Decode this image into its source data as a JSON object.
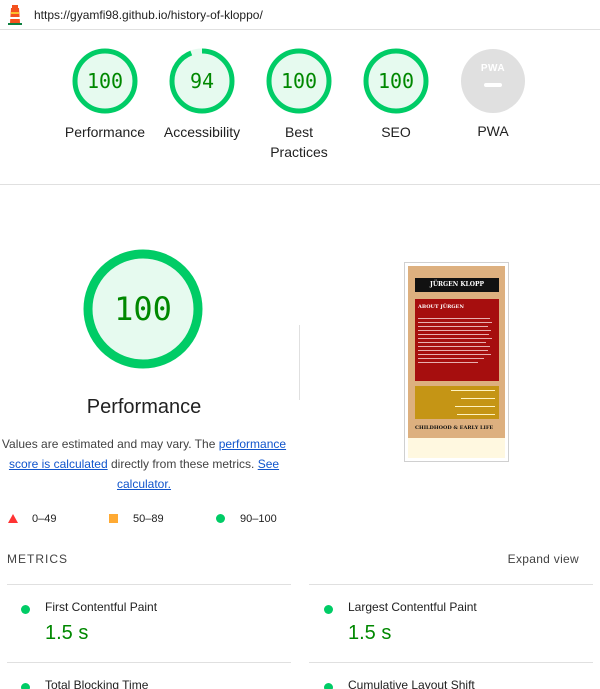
{
  "browser": {
    "url": "https://gyamfi98.github.io/history-of-kloppo/"
  },
  "summary": {
    "gauges": [
      {
        "score": "100",
        "label": "Performance"
      },
      {
        "score": "94",
        "label": "Accessibility"
      },
      {
        "score": "100",
        "label": "Best\nPractices"
      },
      {
        "score": "100",
        "label": "SEO"
      },
      {
        "badge": "PWA",
        "label": "PWA"
      }
    ]
  },
  "performance": {
    "score": "100",
    "title": "Performance",
    "desc_prefix": "Values are estimated and may vary. The ",
    "desc_link": "performance score is calculated",
    "desc_mid": " directly from these metrics. ",
    "desc_calc": "See calculator."
  },
  "legend": {
    "fail": "0–49",
    "average": "50–89",
    "pass": "90–100"
  },
  "screenshot": {
    "title": "JÜRGEN KLOPP",
    "about_heading": "ABOUT JÜRGEN",
    "section_heading": "CHILDHOOD & EARLY LIFE"
  },
  "metrics": {
    "heading": "METRICS",
    "expand_label": "Expand view",
    "items": [
      {
        "label": "First Contentful Paint",
        "value": "1.5 s"
      },
      {
        "label": "Largest Contentful Paint",
        "value": "1.5 s"
      },
      {
        "label": "Total Blocking Time",
        "value": ""
      },
      {
        "label": "Cumulative Layout Shift",
        "value": ""
      }
    ]
  },
  "colors": {
    "pass": "#00cc66",
    "pass_text": "#008800",
    "fail": "#ff3333",
    "average": "#ffaa33",
    "link": "#1155cc"
  }
}
